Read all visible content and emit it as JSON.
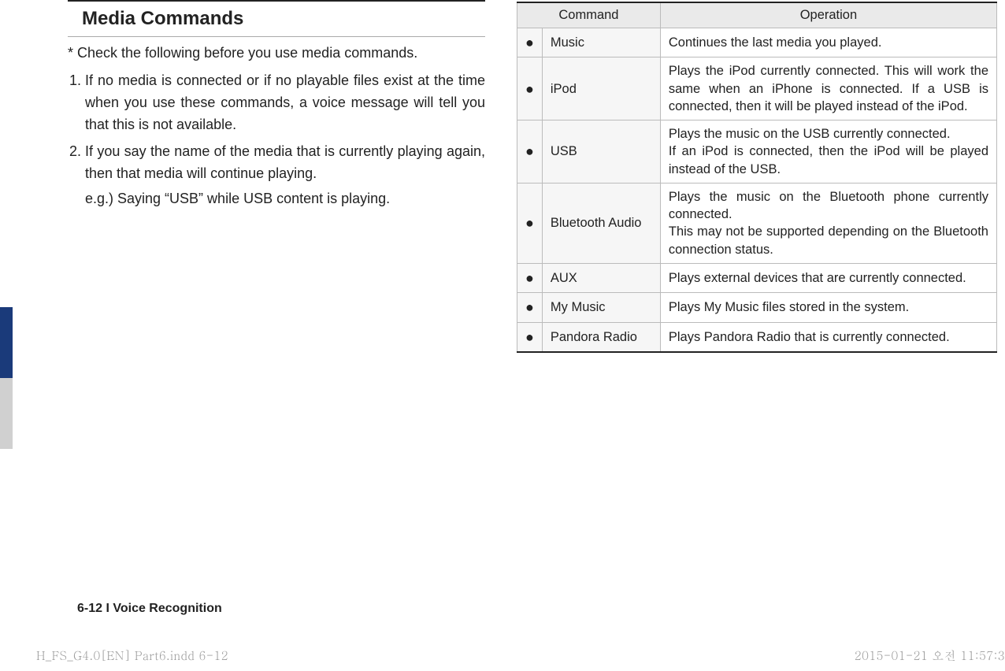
{
  "left": {
    "title": "Media Commands",
    "intro": "* Check the following before you use media commands.",
    "items": [
      {
        "text": "If no media is connected or if no playable files exist at the time when you use these commands, a voice message will tell you that this is not available."
      },
      {
        "text": "If you say the name of the media that is currently playing again, then that media will continue playing.",
        "eg": "e.g.) Saying “USB” while USB content is playing."
      }
    ]
  },
  "table": {
    "headers": {
      "command": "Command",
      "operation": "Operation"
    },
    "rows": [
      {
        "cmd": "Music",
        "op": "Continues the last media you played."
      },
      {
        "cmd": "iPod",
        "op": "Plays the iPod currently connected. This will work the same when an iPhone is connected. If a USB is connected, then it will be played instead of the iPod."
      },
      {
        "cmd": "USB",
        "op": "Plays the music on the USB currently connected.\nIf an iPod is connected, then the iPod will be played instead of the USB."
      },
      {
        "cmd": "Bluetooth Audio",
        "op": "Plays the music on the Bluetooth phone currently connected.\nThis may not be supported depending on the Bluetooth connection status."
      },
      {
        "cmd": "AUX",
        "op": "Plays external devices that are currently connected."
      },
      {
        "cmd": "My Music",
        "op": "Plays My Music files stored in the system."
      },
      {
        "cmd": "Pandora Radio",
        "op": "Plays Pandora Radio that is currently connected."
      }
    ]
  },
  "footer": {
    "section": "6-12 I Voice Recognition",
    "print_left": "H_FS_G4.0[EN] Part6.indd   6-12",
    "print_right": "2015-01-21   오전 11:57:3"
  }
}
